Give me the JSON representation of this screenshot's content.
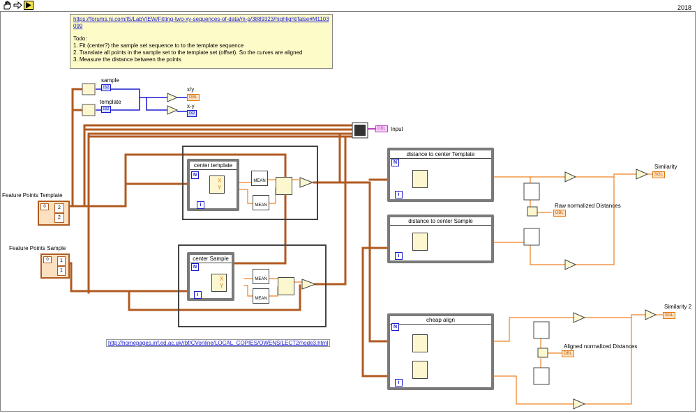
{
  "window": {
    "year": "2018"
  },
  "toolbar": {
    "icons": [
      "hand-icon",
      "arrow-icon",
      "run-icon"
    ]
  },
  "comment": {
    "url": "https://forums.ni.com/t5/LabVIEW/Fitting-two-xy-sequences-of-data/m-p/3889323/highlight/false#M1103099",
    "todo_title": "Todo:",
    "todo_1": "1. Fit (center?) the sample set sequence to to the template sequence",
    "todo_2": "2. Translate all points in the sample set to the template set (offset). So the curves are aligned",
    "todo_3": "3. Measure the distance between the points"
  },
  "labels": {
    "sample": "sample",
    "template": "template",
    "xy": "x/y",
    "x_y": "x-y",
    "input": "Input",
    "feature_template": "Feature Points Template",
    "feature_sample": "Feature Points Sample",
    "similarity": "Similarity",
    "similarity2": "Similarity 2",
    "raw_norm": "Raw normalized Distances",
    "aligned_norm": "Aligned normalized Distances",
    "mean": "MEAN",
    "x": "X",
    "y": "Y"
  },
  "loops": {
    "center_template": "center template",
    "center_sample": "center  Sample",
    "dist_template": "distance to center  Template",
    "dist_sample": "distance to center Sample",
    "cheap_align": "cheap align"
  },
  "terminals": {
    "n": "N",
    "i": "i",
    "i32": "I32",
    "dbl": "DBL",
    "sgl": "SGL",
    "zero": "0",
    "two": "2",
    "one": "1"
  },
  "link2": "http://homepages.inf.ed.ac.uk/rbf/CVonline/LOCAL_COPIES/OWENS/LECT2/node3.html"
}
